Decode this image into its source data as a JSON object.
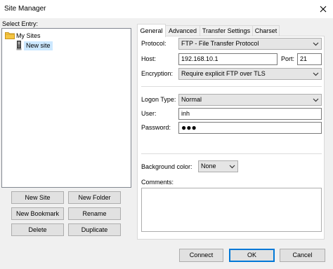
{
  "window": {
    "title": "Site Manager"
  },
  "left": {
    "select_entry_label": "Select Entry:",
    "tree": {
      "root_label": "My Sites",
      "child_label": "New site"
    },
    "buttons": {
      "new_site": "New Site",
      "new_folder": "New Folder",
      "new_bookmark": "New Bookmark",
      "rename": "Rename",
      "delete": "Delete",
      "duplicate": "Duplicate"
    }
  },
  "tabs": [
    {
      "label": "General",
      "active": true
    },
    {
      "label": "Advanced",
      "active": false
    },
    {
      "label": "Transfer Settings",
      "active": false
    },
    {
      "label": "Charset",
      "active": false
    }
  ],
  "general": {
    "protocol": {
      "label": "Protocol:",
      "value": "FTP - File Transfer Protocol"
    },
    "host": {
      "label": "Host:",
      "value": "192.168.10.1"
    },
    "port": {
      "label": "Port:",
      "value": "21"
    },
    "encryption": {
      "label": "Encryption:",
      "value": "Require explicit FTP over TLS"
    },
    "logon_type": {
      "label": "Logon Type:",
      "value": "Normal"
    },
    "user": {
      "label": "User:",
      "value": "inh"
    },
    "password": {
      "label": "Password:",
      "value": "●●●"
    },
    "background_color": {
      "label": "Background color:",
      "value": "None"
    },
    "comments": {
      "label": "Comments:",
      "value": ""
    }
  },
  "footer": {
    "connect": "Connect",
    "ok": "OK",
    "cancel": "Cancel"
  },
  "colors": {
    "selection": "#cce8ff",
    "focus_border": "#0078d7",
    "folder": "#e8b84a"
  }
}
